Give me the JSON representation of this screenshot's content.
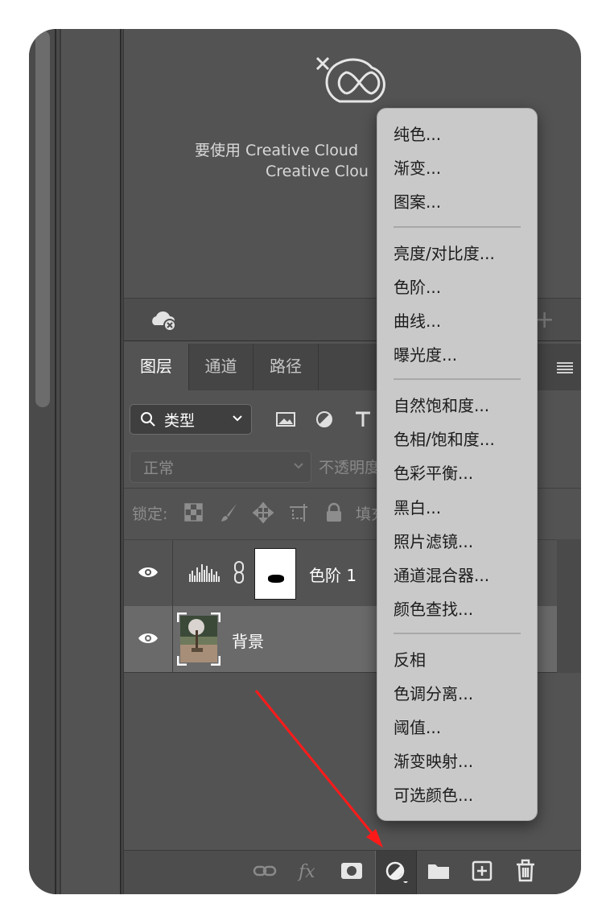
{
  "libraries": {
    "message_line1": "要使用 Creative Cloud",
    "message_line2": "Creative Clou"
  },
  "tabs": [
    {
      "label": "图层",
      "active": true
    },
    {
      "label": "通道",
      "active": false
    },
    {
      "label": "路径",
      "active": false
    }
  ],
  "filter": {
    "kind_label": "类型"
  },
  "blend": {
    "mode": "正常",
    "opacity_label": "不透明度"
  },
  "lock": {
    "label": "锁定:",
    "fill_label": "填充"
  },
  "layers": [
    {
      "name": "色阶 1",
      "visible": true,
      "type": "adjustment"
    },
    {
      "name": "背景",
      "visible": true,
      "type": "image",
      "selected": true
    }
  ],
  "menu": {
    "groups": [
      [
        "纯色...",
        "渐变...",
        "图案..."
      ],
      [
        "亮度/对比度...",
        "色阶...",
        "曲线...",
        "曝光度..."
      ],
      [
        "自然饱和度...",
        "色相/饱和度...",
        "色彩平衡...",
        "黑白...",
        "照片滤镜...",
        "通道混合器...",
        "颜色查找..."
      ],
      [
        "反相",
        "色调分离...",
        "阈值...",
        "渐变映射...",
        "可选颜色..."
      ]
    ]
  },
  "colors": {
    "panel_bg": "#535353",
    "menu_bg": "#c9c9c9",
    "arrow": "#ff1a1a"
  },
  "icons": {
    "bottom_bar": [
      "link-icon",
      "fx-icon",
      "mask-icon",
      "adjustment-icon",
      "folder-icon",
      "new-layer-icon",
      "trash-icon"
    ]
  }
}
